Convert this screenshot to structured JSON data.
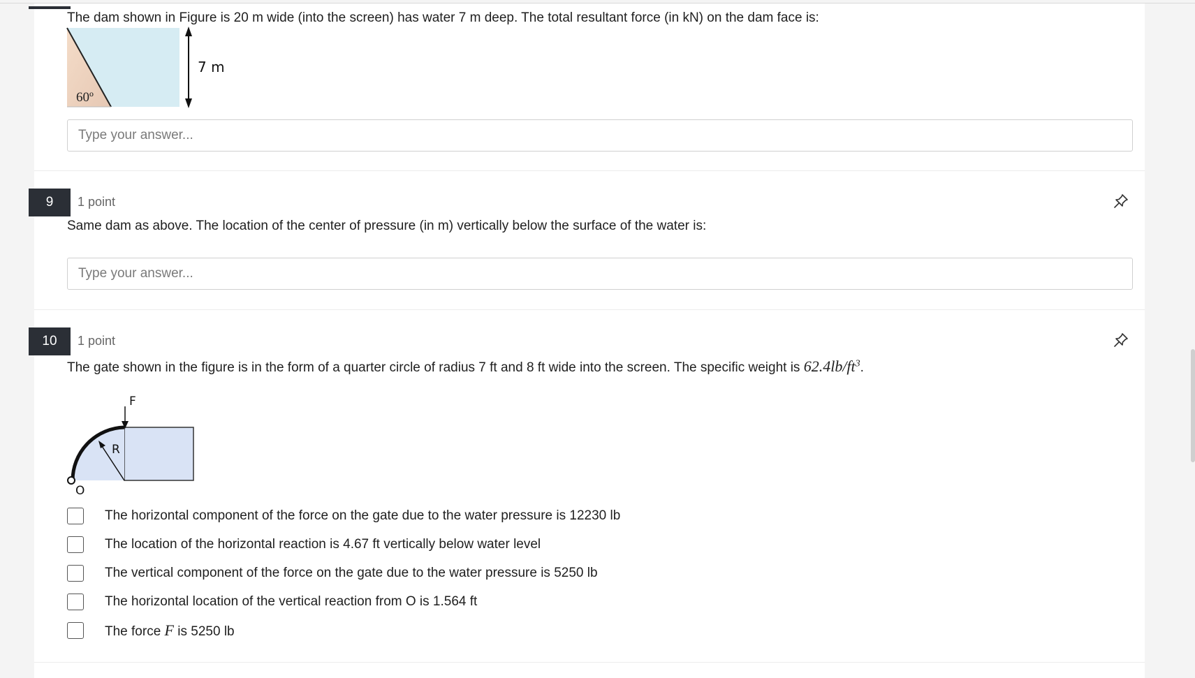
{
  "q8": {
    "text": "The dam shown in Figure is 20 m wide (into the screen) has water 7 m deep. The total resultant force (in kN) on the dam face is:",
    "figure": {
      "angle_label": "60º",
      "depth_label": "7 m"
    },
    "placeholder": "Type your answer..."
  },
  "q9": {
    "number": "9",
    "points": "1 point",
    "text": "Same dam as above. The location of the center of pressure (in m) vertically below the surface of the water is:",
    "placeholder": "Type your answer..."
  },
  "q10": {
    "number": "10",
    "points": "1 point",
    "text_pre": "The gate shown in the figure is in the form of a quarter circle of radius 7 ft and 8 ft wide into the screen. The specific weight is ",
    "math_value": "62.4lb/ft",
    "math_exp": "3",
    "text_post": ".",
    "figure": {
      "force_label": "F",
      "radius_label": "R",
      "origin_label": "O"
    },
    "options": [
      {
        "label": "The horizontal component of the force on the gate due to the water pressure is 12230 lb"
      },
      {
        "label": "The location of the horizontal reaction is 4.67 ft vertically below water level"
      },
      {
        "label": "The vertical component of the force on the gate due to the water pressure is 5250 lb"
      },
      {
        "label": "The horizontal location of the vertical reaction from O is 1.564 ft"
      },
      {
        "label_pre": "The force ",
        "label_math": "F",
        "label_post": " is 5250 lb"
      }
    ]
  },
  "icons": {
    "pin": "pin-icon",
    "checkbox": "checkbox-icon"
  },
  "colors": {
    "number_badge": "#2b2f36",
    "water_fill": "#d6ecf3",
    "gate_fill": "#d9e3f5"
  }
}
